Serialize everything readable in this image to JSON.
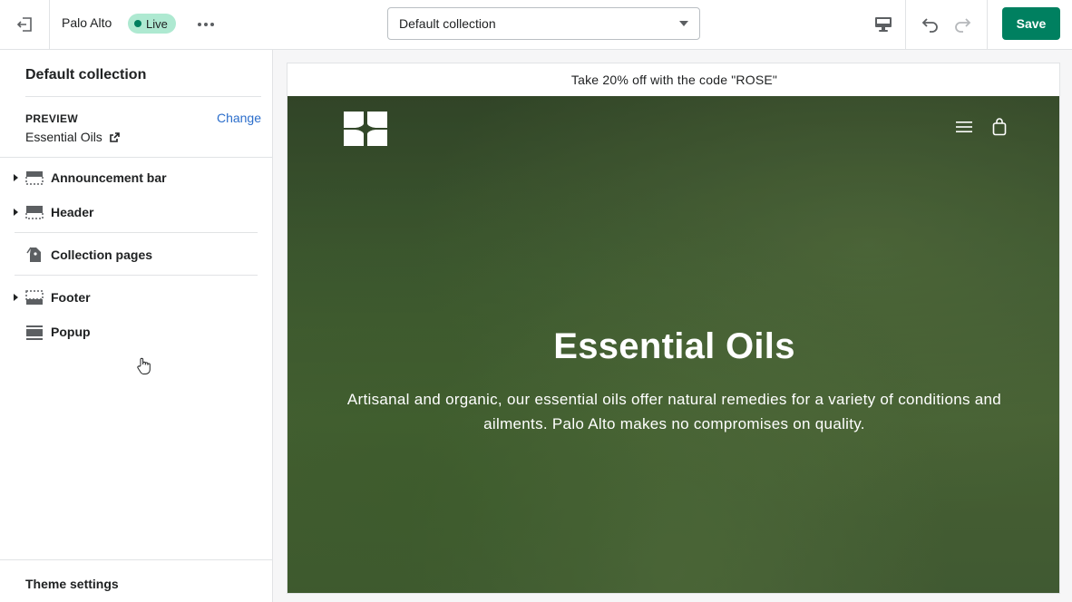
{
  "topbar": {
    "theme_name": "Palo Alto",
    "live_badge": "Live",
    "template_select": "Default collection",
    "save_label": "Save"
  },
  "sidebar": {
    "title": "Default collection",
    "preview_label": "PREVIEW",
    "change_label": "Change",
    "preview_value": "Essential Oils",
    "items": [
      {
        "label": "Announcement bar",
        "icon": "announcement-bar-icon",
        "expandable": true
      },
      {
        "label": "Header",
        "icon": "header-section-icon",
        "expandable": true
      },
      {
        "label": "Collection pages",
        "icon": "collection-tags-icon",
        "expandable": false
      },
      {
        "label": "Footer",
        "icon": "footer-section-icon",
        "expandable": true
      },
      {
        "label": "Popup",
        "icon": "popup-section-icon",
        "expandable": false
      }
    ],
    "theme_settings": "Theme settings"
  },
  "preview": {
    "announcement": "Take 20% off with the code \"ROSE\"",
    "hero_title": "Essential Oils",
    "hero_text": "Artisanal and organic, our essential oils offer natural remedies for a variety of conditions and ailments. Palo Alto makes no compromises on quality."
  },
  "colors": {
    "accent": "#008060",
    "live_badge_bg": "#aee9d1",
    "link": "#2c6ecb"
  }
}
